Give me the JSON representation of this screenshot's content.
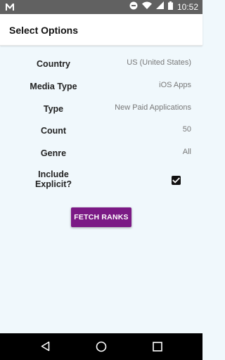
{
  "status_bar": {
    "time": "10:52",
    "icons": [
      "gmail-icon",
      "do-not-disturb-icon",
      "wifi-icon",
      "signal-icon",
      "battery-icon"
    ]
  },
  "app_bar": {
    "title": "Select Options"
  },
  "form": {
    "country": {
      "label": "Country",
      "value": "US (United States)"
    },
    "media_type": {
      "label": "Media Type",
      "value": "iOS Apps"
    },
    "type": {
      "label": "Type",
      "value": "New Paid Applications"
    },
    "count": {
      "label": "Count",
      "value": "50"
    },
    "genre": {
      "label": "Genre",
      "value": "All"
    },
    "include_explicit": {
      "label_line1": "Include",
      "label_line2": "Explicit?",
      "checked": true
    }
  },
  "fetch_button": {
    "label": "FETCH RANKS",
    "color": "#7b1a85"
  },
  "nav_bar": {
    "buttons": [
      "back-icon",
      "home-icon",
      "recents-icon"
    ]
  }
}
